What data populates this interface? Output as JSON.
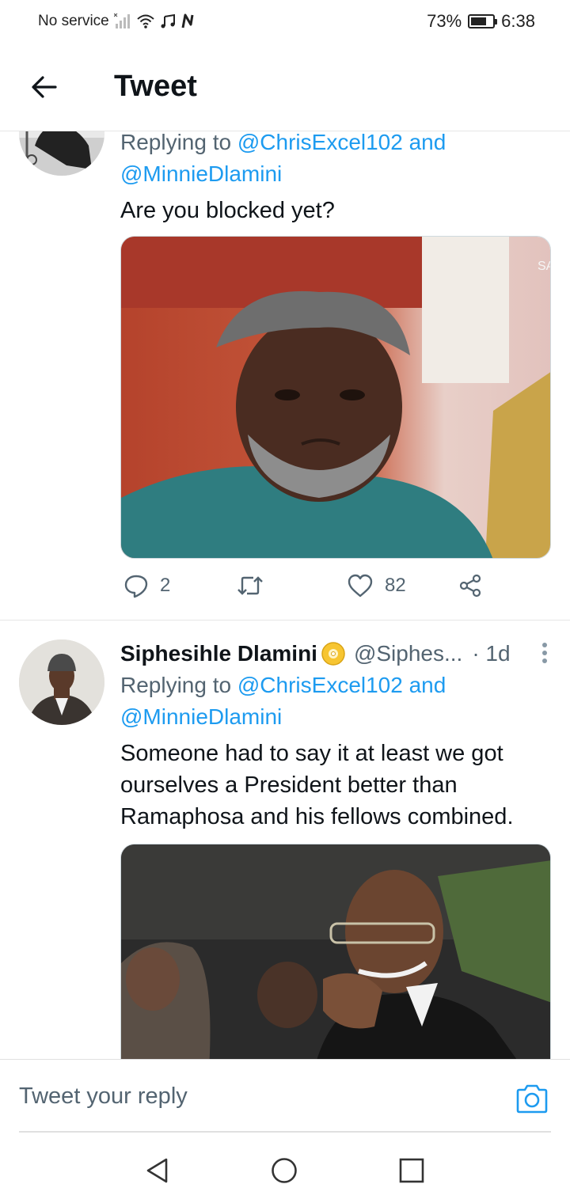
{
  "status": {
    "carrier": "No service",
    "battery_percent_label": "73%",
    "battery_level": 0.73,
    "time": "6:38"
  },
  "header": {
    "title": "Tweet"
  },
  "tweets": [
    {
      "reply_prefix": "Replying to ",
      "reply_user1": "@ChrisExcel102",
      "reply_and": " and",
      "reply_user2": "@MinnieDlamini",
      "text": "Are you blocked yet?",
      "replies": "2",
      "likes": "82"
    },
    {
      "name": "Siphesihle Dlamini",
      "handle": "@Siphes...",
      "time": "· 1d",
      "reply_prefix": "Replying to ",
      "reply_user1": "@ChrisExcel102",
      "reply_and": " and",
      "reply_user2": "@MinnieDlamini",
      "text": "Someone had to say it at least we got ourselves a President better than Ramaphosa and his fellows combined."
    }
  ],
  "reply_bar": {
    "placeholder": "Tweet your reply"
  },
  "colors": {
    "accent": "#1d9bf0",
    "text": "#0f1419",
    "muted": "#536471"
  }
}
